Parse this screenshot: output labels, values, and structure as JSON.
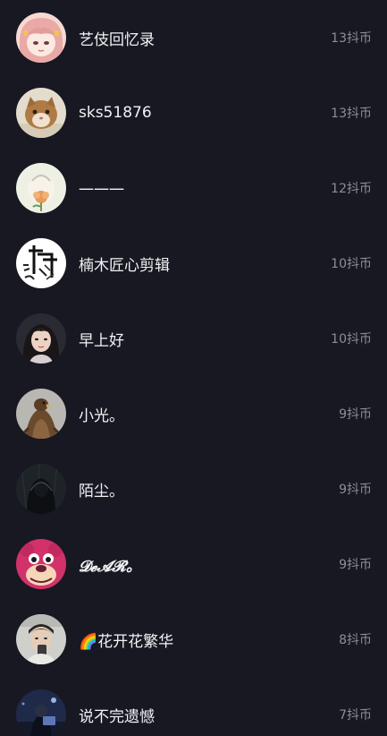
{
  "gift_list": {
    "rows": [
      {
        "name": "艺伎回忆录",
        "coins": "13抖币",
        "avatar": "anime-girl-pink-hair-avatar"
      },
      {
        "name": "sks51876",
        "coins": "13抖币",
        "avatar": "cat-photo-avatar"
      },
      {
        "name": "一一一",
        "coins": "12抖币",
        "avatar": "flower-illustration-avatar"
      },
      {
        "name": "楠木匠心剪辑",
        "coins": "10抖币",
        "avatar": "calligraphy-logo-avatar"
      },
      {
        "name": "早上好",
        "coins": "10抖币",
        "avatar": "woman-portrait-avatar"
      },
      {
        "name": "小光。",
        "coins": "9抖币",
        "avatar": "eagle-photo-avatar"
      },
      {
        "name": "陌尘。",
        "coins": "9抖币",
        "avatar": "dark-hooded-figure-avatar"
      },
      {
        "name": "𝓓𝓮𝓐𝓡。",
        "coins": "9抖币",
        "avatar": "pink-bear-character-avatar"
      },
      {
        "name": "🌈花开花繁华",
        "coins": "8抖币",
        "avatar": "man-selfie-avatar"
      },
      {
        "name": "说不完遗憾",
        "coins": "7抖币",
        "avatar": "night-person-avatar"
      }
    ]
  }
}
